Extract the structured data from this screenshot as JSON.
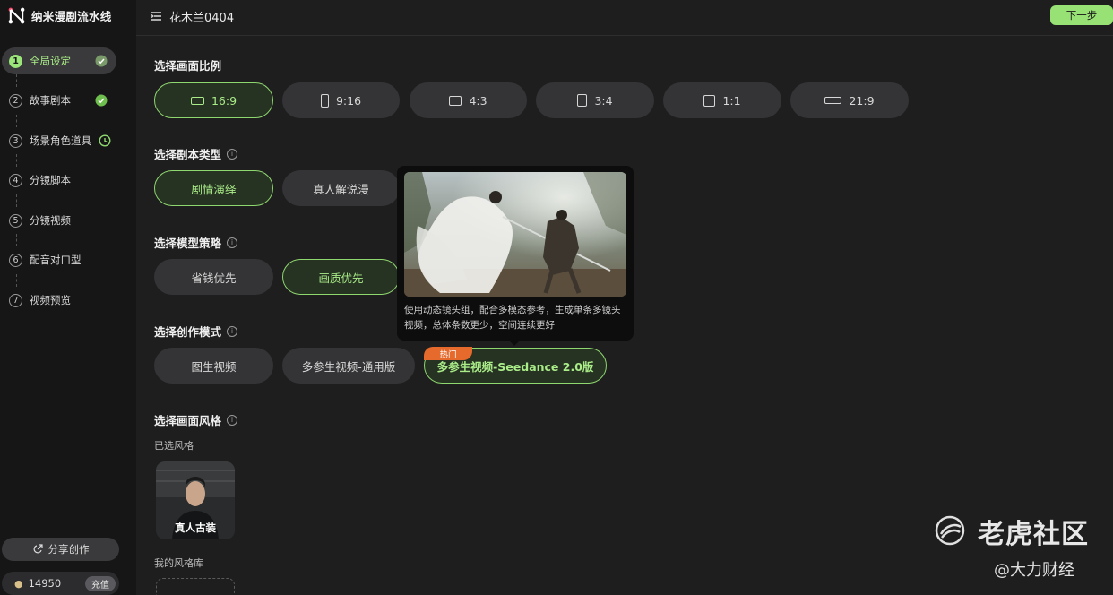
{
  "app": {
    "title": "纳米漫剧流水线"
  },
  "sidebar": {
    "steps": [
      {
        "num": "1",
        "label": "全局设定",
        "status": "done"
      },
      {
        "num": "2",
        "label": "故事剧本",
        "status": "done"
      },
      {
        "num": "3",
        "label": "场景角色道具",
        "status": "pending"
      },
      {
        "num": "4",
        "label": "分镜脚本",
        "status": ""
      },
      {
        "num": "5",
        "label": "分镜视频",
        "status": ""
      },
      {
        "num": "6",
        "label": "配音对口型",
        "status": ""
      },
      {
        "num": "7",
        "label": "视频预览",
        "status": ""
      }
    ],
    "share_label": "分享创作",
    "credits": "14950",
    "topup_label": "充值"
  },
  "header": {
    "project_title": "花木兰0404",
    "next_label": "下一步"
  },
  "aspect": {
    "title": "选择画面比例",
    "options": [
      "16:9",
      "9:16",
      "4:3",
      "3:4",
      "1:1",
      "21:9"
    ],
    "selected": "16:9"
  },
  "script_type": {
    "title": "选择剧本类型",
    "options": [
      "剧情演绎",
      "真人解说漫"
    ],
    "selected": "剧情演绎"
  },
  "model_strategy": {
    "title": "选择模型策略",
    "options": [
      "省钱优先",
      "画质优先"
    ],
    "selected": "画质优先"
  },
  "creation_mode": {
    "title": "选择创作模式",
    "options": [
      "图生视频",
      "多参生视频-通用版",
      "多参生视频-Seedance 2.0版"
    ],
    "selected": "多参生视频-Seedance 2.0版",
    "hot_badge": "热门"
  },
  "tooltip": {
    "text": "使用动态镜头组，配合多模态参考，生成单条多镜头视频，总体条数更少，空间连续更好"
  },
  "style": {
    "title": "选择画面风格",
    "selected_label": "已选风格",
    "selected_style": "真人古装",
    "library_label": "我的风格库"
  },
  "watermark": {
    "brand": "老虎社区",
    "sub": "@大力财经"
  },
  "colors": {
    "accent": "#97e175",
    "hot": "#e56a2c",
    "bg": "#1e1e1f"
  }
}
